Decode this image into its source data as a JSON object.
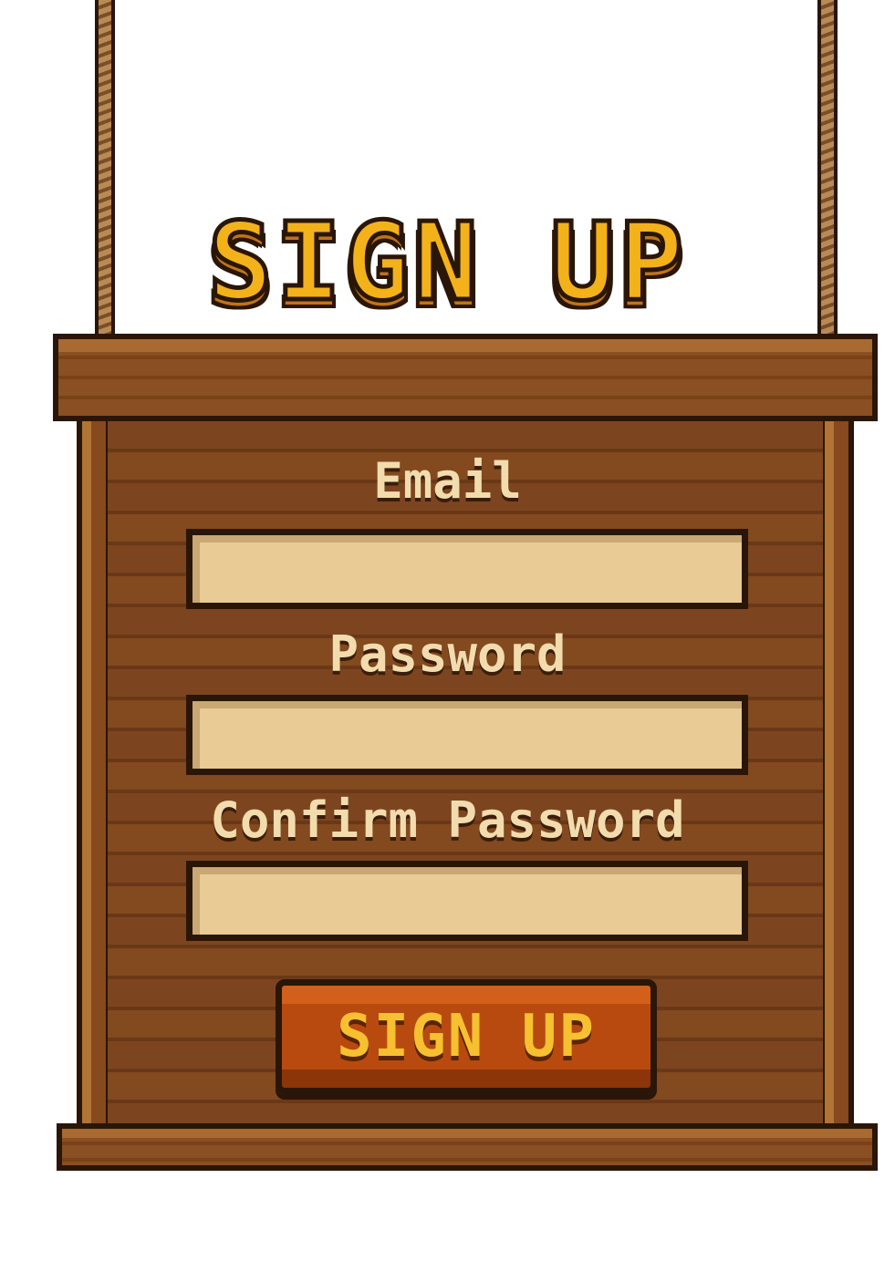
{
  "app": {
    "title": "SIGN UP"
  },
  "form": {
    "email_label": "Email",
    "email_value": "",
    "password_label": "Password",
    "password_value": "",
    "confirm_label": "Confirm Password",
    "confirm_value": "",
    "submit_label": "SIGN UP"
  },
  "colors": {
    "title_yellow": "#f3b21a",
    "wood_dark": "#7c4520",
    "outline": "#2a1608",
    "field_fill": "#e8cb95",
    "button_orange": "#b84a10",
    "label_cream": "#f2dcae"
  }
}
